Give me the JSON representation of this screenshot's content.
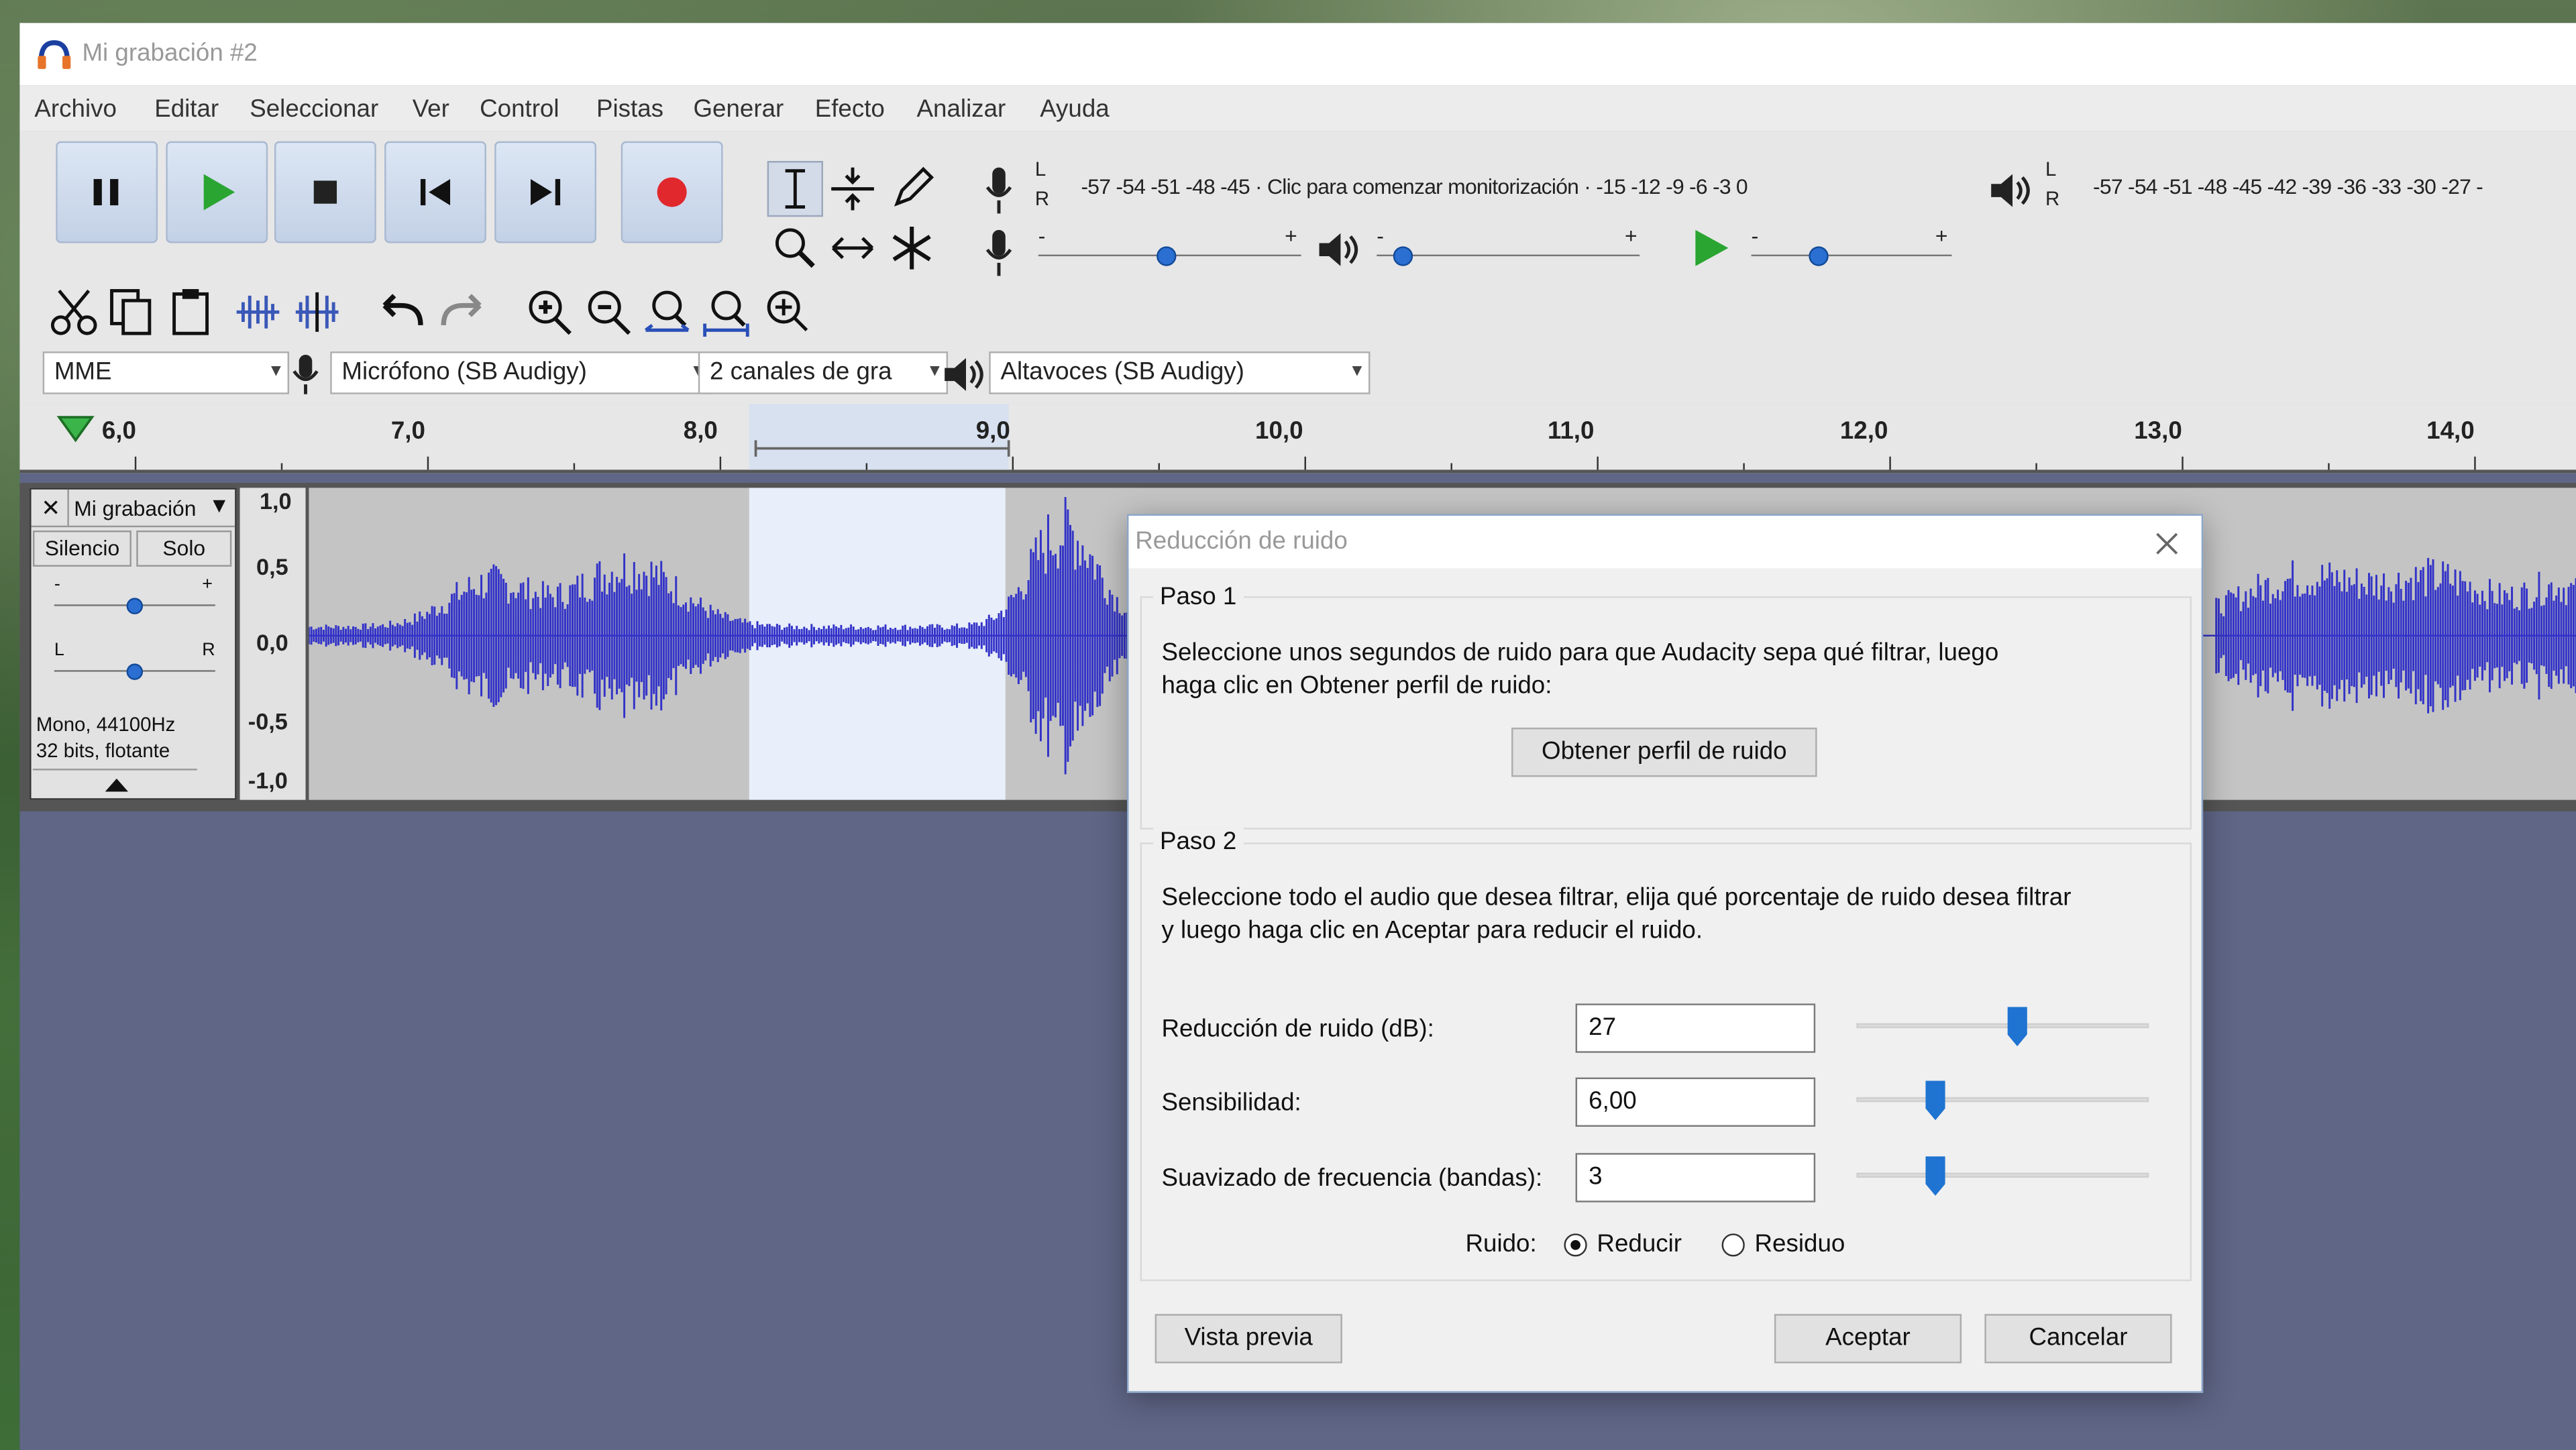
{
  "window": {
    "title": "Mi grabación #2"
  },
  "menu": [
    "Archivo",
    "Editar",
    "Seleccionar",
    "Ver",
    "Control",
    "Pistas",
    "Generar",
    "Efecto",
    "Analizar",
    "Ayuda"
  ],
  "meters": {
    "record_scale": "-57 -54 -51 -48 -45 · Clic para comenzar monitorización · -15 -12 -9 -6 -3 0",
    "play_scale": "-57 -54 -51 -48 -45 -42 -39 -36 -33 -30 -27 -",
    "lr_l": "L",
    "lr_r": "R",
    "slider_minus": "-",
    "slider_plus": "+"
  },
  "devices": {
    "host": "MME",
    "mic": "Micrófono (SB Audigy)",
    "channels": "2 canales de gra",
    "speakers": "Altavoces (SB Audigy)"
  },
  "ruler": [
    "6,0",
    "7,0",
    "8,0",
    "9,0",
    "10,0",
    "11,0",
    "12,0",
    "13,0",
    "14,0"
  ],
  "track": {
    "close": "✕",
    "name": "Mi grabación",
    "mute": "Silencio",
    "solo": "Solo",
    "gain_minus": "-",
    "gain_plus": "+",
    "pan_l": "L",
    "pan_r": "R",
    "info1": "Mono, 44100Hz",
    "info2": "32 bits, flotante",
    "scale": [
      "1,0",
      "0,5",
      "0,0",
      "-0,5",
      "-1,0"
    ]
  },
  "dialog": {
    "title": "Reducción de ruido",
    "step1_label": "Paso 1",
    "step1_text1": "Seleccione unos segundos de ruido para que Audacity sepa qué filtrar, luego",
    "step1_text2": "haga clic en Obtener perfil de ruido:",
    "get_profile": "Obtener perfil de ruido",
    "step2_label": "Paso 2",
    "step2_text1": "Seleccione todo el audio que desea filtrar, elija qué porcentaje de ruido desea filtrar",
    "step2_text2": "y luego haga clic en Aceptar para reducir el ruido.",
    "params": [
      {
        "label": "Reducción de ruido (dB):",
        "value": "27",
        "level": 0.55
      },
      {
        "label": "Sensibilidad:",
        "value": "6,00",
        "level": 0.27
      },
      {
        "label": "Suavizado de frecuencia (bandas):",
        "value": "3",
        "level": 0.27
      }
    ],
    "noise_label": "Ruido:",
    "opt_reduce": "Reducir",
    "opt_residue": "Residuo",
    "preview": "Vista previa",
    "ok": "Aceptar",
    "cancel": "Cancelar"
  },
  "colors": {
    "waveform": "#3232c8",
    "record": "#e0282d",
    "play": "#2aa532",
    "accent": "#1f73d1"
  }
}
